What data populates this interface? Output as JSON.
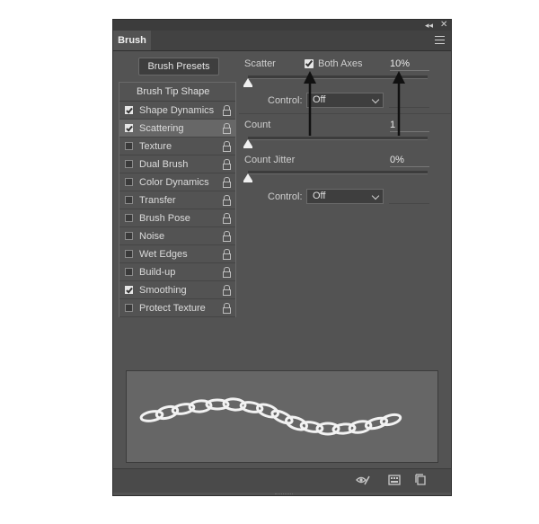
{
  "panel": {
    "tab_title": "Brush",
    "collapse_glyph": "◂◂",
    "close_glyph": "✕",
    "presets_label": "Brush Presets"
  },
  "brush_list": {
    "header": "Brush Tip Shape",
    "items": [
      {
        "label": "Shape Dynamics",
        "checked": true,
        "selected": false
      },
      {
        "label": "Scattering",
        "checked": true,
        "selected": true
      },
      {
        "label": "Texture",
        "checked": false,
        "selected": false
      },
      {
        "label": "Dual Brush",
        "checked": false,
        "selected": false
      },
      {
        "label": "Color Dynamics",
        "checked": false,
        "selected": false
      },
      {
        "label": "Transfer",
        "checked": false,
        "selected": false
      },
      {
        "label": "Brush Pose",
        "checked": false,
        "selected": false
      },
      {
        "label": "Noise",
        "checked": false,
        "selected": false
      },
      {
        "label": "Wet Edges",
        "checked": false,
        "selected": false
      },
      {
        "label": "Build-up",
        "checked": false,
        "selected": false
      },
      {
        "label": "Smoothing",
        "checked": true,
        "selected": false
      },
      {
        "label": "Protect Texture",
        "checked": false,
        "selected": false
      }
    ]
  },
  "scattering": {
    "scatter_label": "Scatter",
    "both_axes_label": "Both Axes",
    "both_axes_checked": true,
    "scatter_value": "10%",
    "control_label": "Control:",
    "control_value": "Off",
    "count_label": "Count",
    "count_value": "1",
    "count_jitter_label": "Count Jitter",
    "count_jitter_value": "0%",
    "control2_label": "Control:",
    "control2_value": "Off"
  },
  "icons": {
    "bottom": [
      "eye-brush-icon",
      "grid-icon",
      "new-preset-icon"
    ],
    "annotation": "up-arrow-icon"
  }
}
